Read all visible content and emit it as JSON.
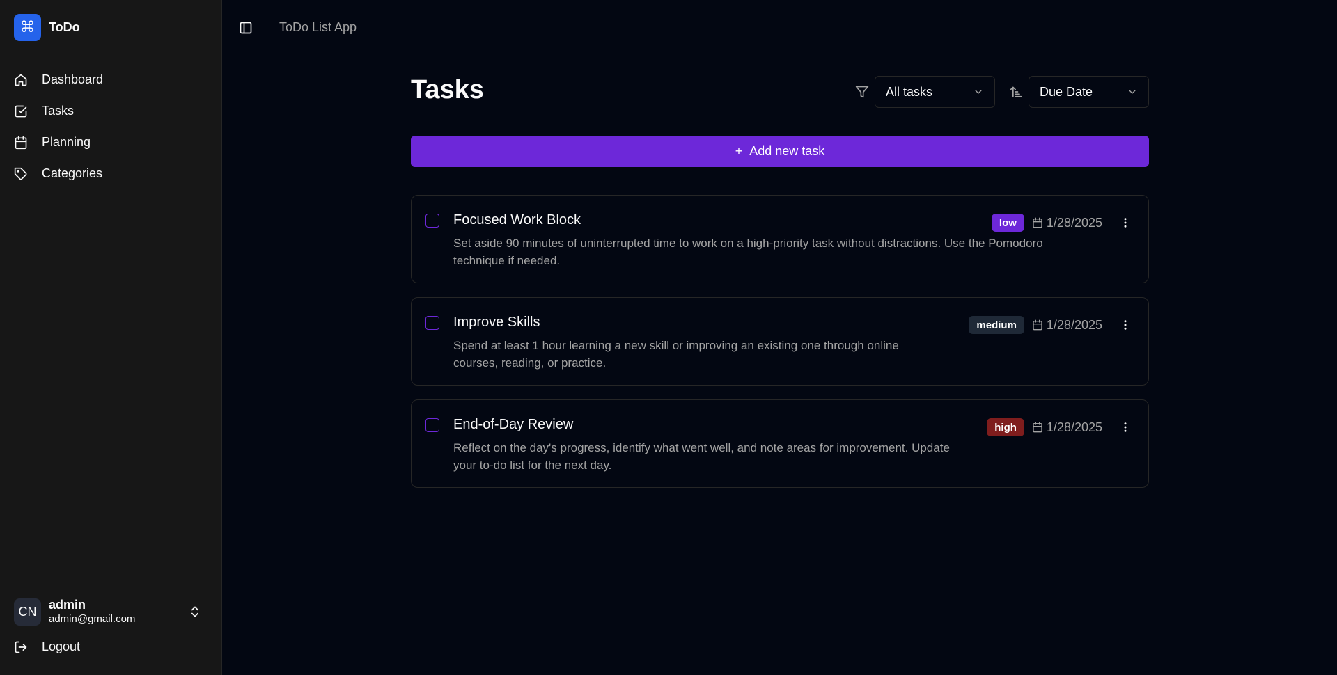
{
  "app": {
    "brand_name": "ToDo",
    "brand_logo": "command-icon",
    "title": "ToDo List App"
  },
  "sidebar": {
    "items": [
      {
        "label": "Dashboard",
        "icon": "home-icon"
      },
      {
        "label": "Tasks",
        "icon": "check-square-icon"
      },
      {
        "label": "Planning",
        "icon": "calendar-icon"
      },
      {
        "label": "Categories",
        "icon": "tag-icon"
      }
    ],
    "user": {
      "initials": "CN",
      "name": "admin",
      "email": "admin@gmail.com"
    },
    "logout_label": "Logout"
  },
  "main": {
    "title": "Tasks",
    "filter": {
      "value": "All tasks"
    },
    "sort": {
      "value": "Due Date"
    },
    "add_button": {
      "icon": "+",
      "label": "Add new task"
    },
    "tasks": [
      {
        "title": "Focused Work Block",
        "description": "Set aside 90 minutes of uninterrupted time to work on a high-priority task without distractions. Use the Pomodoro technique if needed.",
        "priority": "low",
        "priority_color": "#6d28d9",
        "date": "1/28/2025"
      },
      {
        "title": "Improve Skills",
        "description": "Spend at least 1 hour learning a new skill or improving an existing one through online courses, reading, or practice.",
        "priority": "medium",
        "priority_color": "#1f2937",
        "date": "1/28/2025"
      },
      {
        "title": "End-of-Day Review",
        "description": "Reflect on the day's progress, identify what went well, and note areas for improvement. Update your to-do list for the next day.",
        "priority": "high",
        "priority_color": "#7f1d1d",
        "date": "1/28/2025"
      }
    ]
  },
  "colors": {
    "background": "#030712",
    "sidebar": "#171717",
    "accent": "#6d28d9",
    "brand": "#2563eb"
  }
}
